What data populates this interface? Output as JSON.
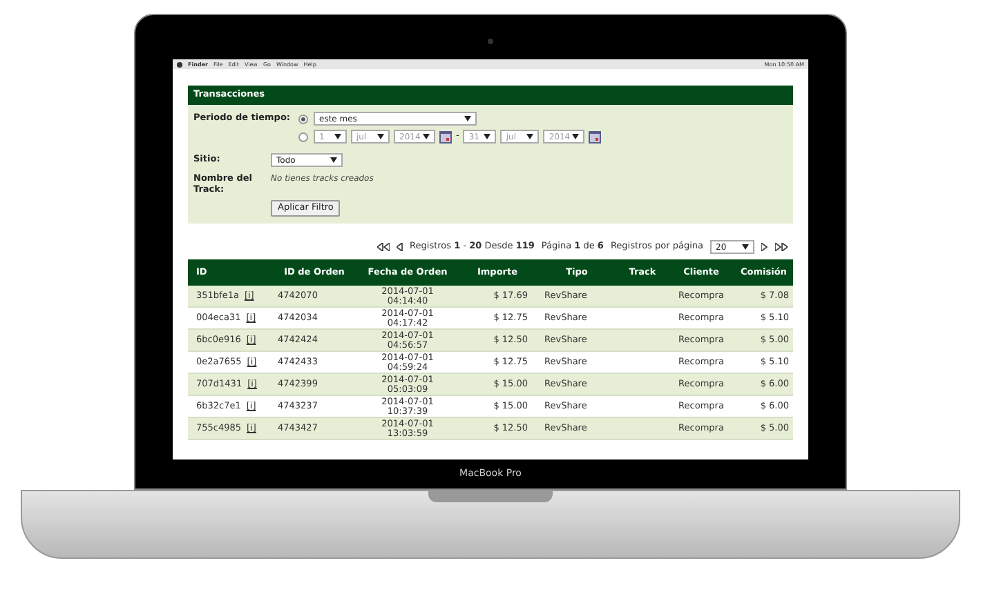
{
  "laptop": {
    "brand": "MacBook Pro"
  },
  "menu_bar": {
    "items": [
      "Finder",
      "File",
      "Edit",
      "View",
      "Go",
      "Window",
      "Help"
    ],
    "clock": "Mon 10:50 AM"
  },
  "panel": {
    "title": "Transacciones",
    "period": {
      "label": "Periodo de tiempo:",
      "options": [
        {
          "kind": "preset",
          "selected": true,
          "value": "este mes"
        },
        {
          "kind": "range",
          "selected": false,
          "from": [
            "1",
            "jul",
            "2014"
          ],
          "separator": "-",
          "to": [
            "31",
            "jul",
            "2014"
          ]
        }
      ]
    },
    "site": {
      "label": "Sitio:",
      "value": "Todo"
    },
    "track": {
      "label": "Nombre del Track:",
      "note": "No tienes tracks creados"
    },
    "button": "Aplicar Filtro"
  },
  "pagination": {
    "summary": "Registros **1** - **20** Desde **119**",
    "page": "Página **1** de **6**",
    "per_page_label": "Registros por página",
    "per_page": "20"
  },
  "table": {
    "columns": [
      "ID",
      "ID de Orden",
      "Fecha de Orden",
      "Importe",
      "Tipo",
      "Track",
      "Cliente",
      "Comisión"
    ],
    "rows": [
      {
        "id": "351bfe1a",
        "info": "[i]",
        "order": "4742070",
        "date": "2014-07-01",
        "time": "04:14:40",
        "amount": "$ 17.69",
        "type": "RevShare",
        "client": "Recompra",
        "commission": "$ 7.08"
      },
      {
        "id": "004eca31",
        "info": "[i]",
        "order": "4742034",
        "date": "2014-07-01",
        "time": "04:17:42",
        "amount": "$ 12.75",
        "type": "RevShare",
        "client": "Recompra",
        "commission": "$ 5.10"
      },
      {
        "id": "6bc0e916",
        "info": "[i]",
        "order": "4742424",
        "date": "2014-07-01",
        "time": "04:56:57",
        "amount": "$ 12.50",
        "type": "RevShare",
        "client": "Recompra",
        "commission": "$ 5.00"
      },
      {
        "id": "0e2a7655",
        "info": "[i]",
        "order": "4742433",
        "date": "2014-07-01",
        "time": "04:59:24",
        "amount": "$ 12.75",
        "type": "RevShare",
        "client": "Recompra",
        "commission": "$ 5.10"
      },
      {
        "id": "707d1431",
        "info": "[i]",
        "order": "4742399",
        "date": "2014-07-01",
        "time": "05:03:09",
        "amount": "$ 15.00",
        "type": "RevShare",
        "client": "Recompra",
        "commission": "$ 6.00"
      },
      {
        "id": "6b32c7e1",
        "info": "[i]",
        "order": "4743237",
        "date": "2014-07-01",
        "time": "10:37:39",
        "amount": "$ 15.00",
        "type": "RevShare",
        "client": "Recompra",
        "commission": "$ 6.00"
      },
      {
        "id": "755c4985",
        "info": "[i]",
        "order": "4743427",
        "date": "2014-07-01",
        "time": "13:03:59",
        "amount": "$ 12.50",
        "type": "RevShare",
        "client": "Recompra",
        "commission": "$ 5.00"
      }
    ]
  }
}
